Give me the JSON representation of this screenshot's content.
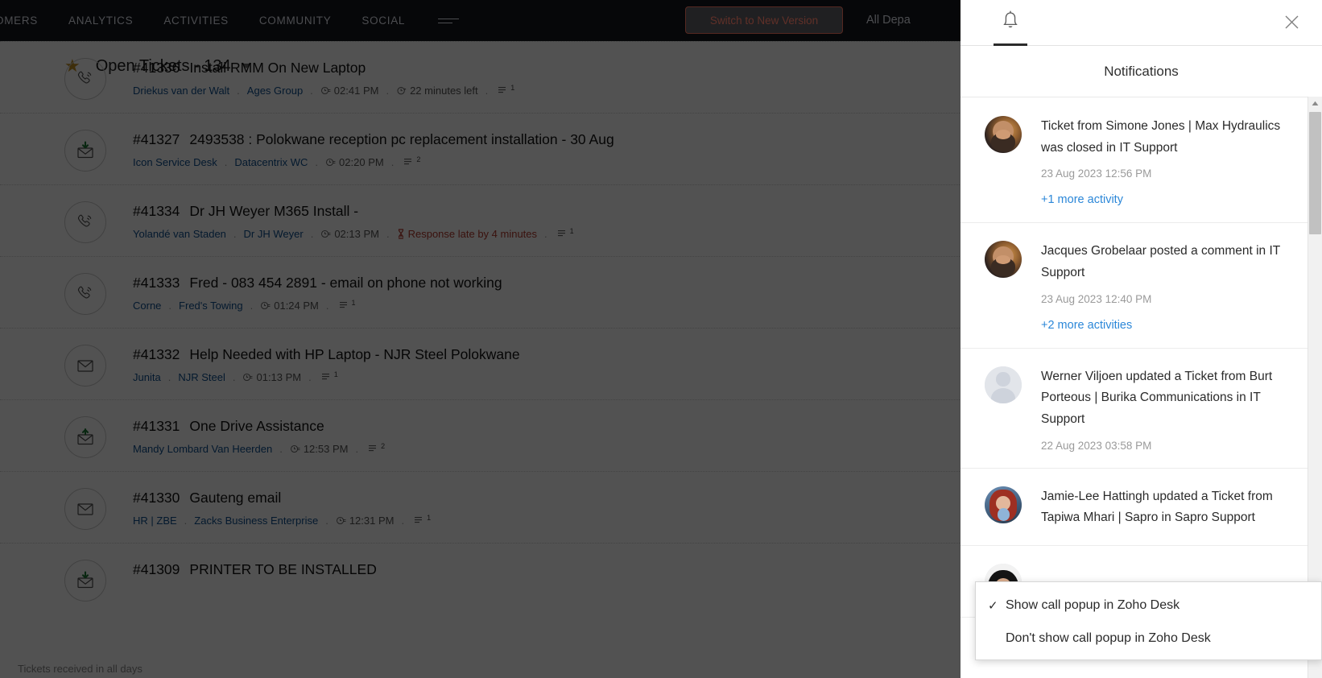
{
  "topnav": {
    "links": [
      "OMERS",
      "ANALYTICS",
      "ACTIVITIES",
      "COMMUNITY",
      "SOCIAL"
    ],
    "more_icon": "hamburger-more-icon",
    "switch_button": "Switch to New Version",
    "department_selector": "All Depa",
    "accent_border": "#9c4a3c",
    "accent_text": "#b0584a",
    "bar_bg": "#0c0d11"
  },
  "ticket_list": {
    "star_icon": "star-icon",
    "title": "Open Tickets - 134",
    "caret_icon": "chevron-down-icon",
    "footer_note": "Tickets received in all days",
    "link_color": "#0f4f8f",
    "rows": [
      {
        "icon": "phone-icon",
        "id": "#41336",
        "subject": "Install RMM On New Laptop",
        "contact": "Driekus van der Walt",
        "account": "Ages Group",
        "time": "02:41 PM",
        "sla": "22 minutes left",
        "sla_late": false,
        "thread_count": "1"
      },
      {
        "icon": "mail-received-icon",
        "id": "#41327",
        "subject": "2493538 : Polokwane reception pc replacement installation - 30 Aug",
        "contact": "Icon Service Desk",
        "account": "Datacentrix WC",
        "time": "02:20 PM",
        "sla": "",
        "sla_late": false,
        "thread_count": "2"
      },
      {
        "icon": "phone-icon",
        "id": "#41334",
        "subject": "Dr JH Weyer M365 Install -",
        "contact": "Yolandé van Staden",
        "account": "Dr JH Weyer",
        "time": "02:13 PM",
        "sla": "Response late by 4 minutes",
        "sla_late": true,
        "thread_count": "1"
      },
      {
        "icon": "phone-icon",
        "id": "#41333",
        "subject": "Fred - 083 454 2891 - email on phone not working",
        "contact": "Corne",
        "account": "Fred's Towing",
        "time": "01:24 PM",
        "sla": "",
        "sla_late": false,
        "thread_count": "1"
      },
      {
        "icon": "mail-icon",
        "id": "#41332",
        "subject": "Help Needed with HP Laptop - NJR Steel Polokwane",
        "contact": "Junita",
        "account": "NJR Steel",
        "time": "01:13 PM",
        "sla": "",
        "sla_late": false,
        "thread_count": "1"
      },
      {
        "icon": "mail-sent-icon",
        "id": "#41331",
        "subject": "One Drive Assistance",
        "contact": "Mandy Lombard Van Heerden",
        "account": "",
        "time": "12:53 PM",
        "sla": "",
        "sla_late": false,
        "thread_count": "2"
      },
      {
        "icon": "mail-icon",
        "id": "#41330",
        "subject": "Gauteng email",
        "contact": "HR | ZBE",
        "account": "Zacks Business Enterprise",
        "time": "12:31 PM",
        "sla": "",
        "sla_late": false,
        "thread_count": "1"
      },
      {
        "icon": "mail-received-icon",
        "id": "#41309",
        "subject": "PRINTER TO BE INSTALLED",
        "contact": "",
        "account": "",
        "time": "",
        "sla": "",
        "sla_late": false,
        "thread_count": ""
      }
    ]
  },
  "notifications": {
    "tab_icon": "bell-icon",
    "close_icon": "close-icon",
    "heading": "Notifications",
    "link_color": "#2b87d8",
    "items": [
      {
        "avatar": "avatar-bearded-man",
        "avatar_type": "photo-warm",
        "message": "Ticket from Simone Jones | Max Hydraulics was closed in IT Support",
        "time": "23 Aug 2023 12:56 PM",
        "more_link": "+1 more activity"
      },
      {
        "avatar": "avatar-bearded-man",
        "avatar_type": "photo-warm",
        "message": "Jacques Grobelaar posted a comment in IT Support",
        "time": "23 Aug 2023 12:40 PM",
        "more_link": "+2 more activities"
      },
      {
        "avatar": "avatar-placeholder",
        "avatar_type": "placeholder",
        "message": "Werner Viljoen updated a Ticket from Burt Porteous | Burika Communications in IT Support",
        "time": "22 Aug 2023 03:58 PM",
        "more_link": ""
      },
      {
        "avatar": "avatar-red-haired-woman",
        "avatar_type": "photo-red",
        "message": "Jamie-Lee Hattingh updated a Ticket from Tapiwa Mhari | Sapro in Sapro Support",
        "time": "",
        "more_link": ""
      },
      {
        "avatar": "avatar-dark-haired-person",
        "avatar_type": "photo-dark",
        "message": "",
        "time": "",
        "more_link": ""
      }
    ],
    "scrollbar": {
      "up_arrow_icon": "scroll-up-arrow-icon",
      "thumb": "scroll-thumb"
    }
  },
  "call_popup_menu": {
    "items": [
      {
        "label": "Show call popup in Zoho Desk",
        "checked": true
      },
      {
        "label": "Don't show call popup in Zoho Desk",
        "checked": false
      }
    ],
    "check_icon": "check-icon"
  }
}
